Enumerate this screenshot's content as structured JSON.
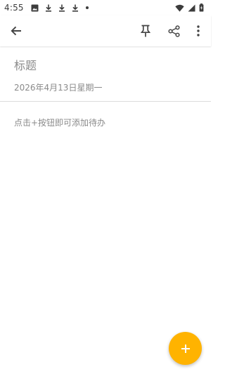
{
  "status_bar": {
    "time": "4:55",
    "left_icons": [
      "image-icon",
      "download-icon",
      "download-icon",
      "download-icon",
      "dot-icon"
    ],
    "right_icons": [
      "wifi-icon",
      "signal-icon",
      "battery-icon"
    ]
  },
  "toolbar": {
    "back_icon": "arrow-left-icon",
    "pin_icon": "pin-icon",
    "share_icon": "share-icon",
    "more_icon": "more-vertical-icon"
  },
  "note": {
    "title_placeholder": "标题",
    "date": "2026年4月13日星期一",
    "empty_hint": "点击+按钮即可添加待办"
  },
  "fab": {
    "icon": "plus-icon",
    "color": "#FFB300"
  }
}
